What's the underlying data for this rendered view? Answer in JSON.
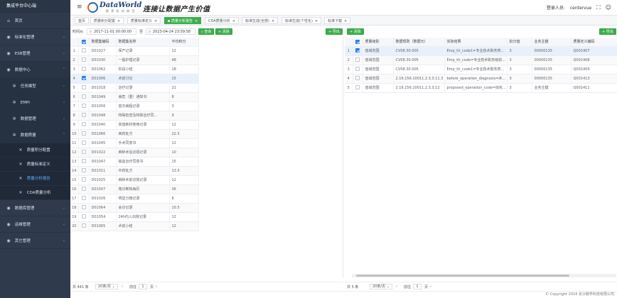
{
  "sidebar": {
    "brand": "集成平台中心端",
    "items": [
      {
        "label": "首页",
        "icon": "home-icon"
      },
      {
        "label": "标准化管理",
        "icon": "globe-icon"
      },
      {
        "label": "ESB管理",
        "icon": "globe-icon"
      },
      {
        "label": "数据中心",
        "icon": "globe-icon"
      },
      {
        "label": "任务模型",
        "icon": "gear-icon"
      },
      {
        "label": "EMPI",
        "icon": "gear-icon"
      },
      {
        "label": "数据管理",
        "icon": "gear-icon"
      },
      {
        "label": "数据质量",
        "icon": "gear-icon"
      },
      {
        "label": "质量积分配置",
        "icon": "tools-icon"
      },
      {
        "label": "质量标准定义",
        "icon": "tools-icon"
      },
      {
        "label": "质量分析报告",
        "icon": "tools-icon"
      },
      {
        "label": "CDA质量分析",
        "icon": "tools-icon"
      },
      {
        "label": "数据库管理",
        "icon": "globe-icon"
      },
      {
        "label": "运维管理",
        "icon": "globe-icon"
      },
      {
        "label": "其它管理",
        "icon": "globe-icon"
      }
    ]
  },
  "header": {
    "logo_text": "DataWorld",
    "logo_sub": "数 界 科 技 典 范",
    "slogan": "连接让数据产生价值",
    "user_label": "登录人员:",
    "user_name": "centervue",
    "fullscreen_icon": "fullscreen-icon",
    "user_icon": "user-icon"
  },
  "tabs": [
    {
      "label": "首页",
      "active": false
    },
    {
      "label": "质量积分配置",
      "active": false
    },
    {
      "label": "质量标准定义",
      "active": false
    },
    {
      "label": "质量分析报告",
      "active": true
    },
    {
      "label": "CDA质量分析",
      "active": false
    },
    {
      "label": "标准生成(全部)",
      "active": false
    },
    {
      "label": "标准生成(个性化)",
      "active": false
    },
    {
      "label": "标准下载",
      "active": false
    }
  ],
  "filters": {
    "time_label": "时间从",
    "date_from": "2017-11-01 00:00:00",
    "to_label": "至",
    "date_to": "2023-04-24 23:59:58",
    "search_label": "查询",
    "reset_label": "清除",
    "export_label": "导出"
  },
  "left_table": {
    "columns": [
      "数据集编码",
      "数据集名称",
      "平均积分"
    ],
    "rows": [
      {
        "idx": "1",
        "code": "D01027",
        "name": "保产记录",
        "score": "12"
      },
      {
        "idx": "2",
        "code": "D01030",
        "name": "一般护理记录",
        "score": "48"
      },
      {
        "idx": "3",
        "code": "D01062",
        "name": "阶段小结",
        "score": "18"
      },
      {
        "idx": "4",
        "code": "D01006",
        "name": "术前讨论",
        "score": "15",
        "selected": true
      },
      {
        "idx": "5",
        "code": "D01018",
        "name": "治疗记录",
        "score": "21"
      },
      {
        "idx": "6",
        "code": "D01049",
        "name": "病危（重）通知书",
        "score": "8"
      },
      {
        "idx": "7",
        "code": "D01056",
        "name": "首次病程记录",
        "score": "3"
      },
      {
        "idx": "8",
        "code": "D01048",
        "name": "特殊检查及特殊治疗同...",
        "score": "9"
      },
      {
        "idx": "9",
        "code": "D01040",
        "name": "高值耗材使用记录",
        "score": "12"
      },
      {
        "idx": "10",
        "code": "D01066",
        "name": "西药处方",
        "score": "22.5"
      },
      {
        "idx": "11",
        "code": "D01045",
        "name": "手术同意书",
        "score": "12"
      },
      {
        "idx": "12",
        "code": "D01022",
        "name": "麻醉术后访视记录",
        "score": "10"
      },
      {
        "idx": "13",
        "code": "D01047",
        "name": "输血治疗同意书",
        "score": "15"
      },
      {
        "idx": "14",
        "code": "D01011",
        "name": "中药处方",
        "score": "13.5"
      },
      {
        "idx": "15",
        "code": "D01025",
        "name": "麻醉术前访视记录",
        "score": "12"
      },
      {
        "idx": "16",
        "code": "D01007",
        "name": "角诊断知病历",
        "score": "36"
      },
      {
        "idx": "17",
        "code": "D01026",
        "name": "明显分娩记录",
        "score": "6"
      },
      {
        "idx": "18",
        "code": "D01064",
        "name": "会诊记录",
        "score": "10.5"
      },
      {
        "idx": "19",
        "code": "D01054",
        "name": "24h内入出院记录",
        "score": "12"
      },
      {
        "idx": "20",
        "code": "D01065",
        "name": "术前小结",
        "score": "12"
      }
    ],
    "pager": {
      "total": "共 441 条",
      "page_size": "20条/页",
      "goto_label": "前往",
      "page": "1",
      "page_unit": "页"
    }
  },
  "right_table": {
    "export_label": "导出",
    "clear_label": "清除",
    "columns": [
      "质量级别",
      "数据规则（数据元）",
      "实际结果",
      "扣分值",
      "业务主键",
      "质量定义编码"
    ],
    "rows": [
      {
        "idx": "1",
        "level": "值域范围",
        "rule": "CV08.30.005",
        "result": "Emp_tit_code1=专业技术职务类...",
        "deduct": "3",
        "key": "00000135",
        "def": "Q001407",
        "selected": true
      },
      {
        "idx": "2",
        "level": "值域范围",
        "rule": "CV08.30.005",
        "result": "Emp_tit_code=专业技术职务级别...",
        "deduct": "3",
        "key": "00000135",
        "def": "Q001408"
      },
      {
        "idx": "3",
        "level": "值域范围",
        "rule": "CV08.30.005",
        "result": "Emp_tit_code1=专业技术职务类...",
        "deduct": "3",
        "key": "00000135",
        "def": "Q001409"
      },
      {
        "idx": "4",
        "level": "值域范围",
        "rule": "2.16.156.10011.2.3.3.11.3",
        "result": "before_operation_diagnosis=术...",
        "deduct": "3",
        "key": "00000135",
        "def": "Q001413"
      },
      {
        "idx": "5",
        "level": "值域范围",
        "rule": "2.16.156.10011.2.3.3.12",
        "result": "proposed_operation_code=拟实...",
        "deduct": "3",
        "key": "业务主键",
        "def": "Q001411"
      }
    ],
    "pager": {
      "total": "共 5 条",
      "page_size": "20条/页",
      "goto_label": "前往",
      "page": "1",
      "page_unit": "页"
    }
  },
  "footer": "© Copyright 2016 长沙数界科技有限公司"
}
